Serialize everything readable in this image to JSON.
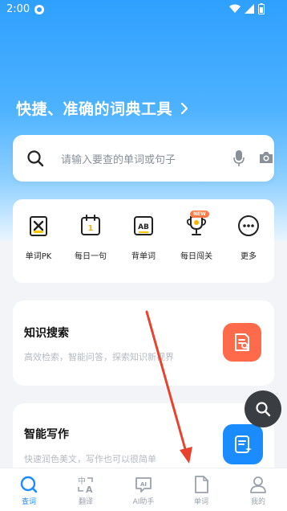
{
  "status_bar": {
    "time": "2:00"
  },
  "hero": {
    "tagline": "快捷、准确的词典工具"
  },
  "search": {
    "placeholder": "请输入要查的单词或句子"
  },
  "tools": [
    {
      "label": "单词PK",
      "icon": "word-pk-icon"
    },
    {
      "label": "每日一句",
      "icon": "calendar-icon"
    },
    {
      "label": "背单词",
      "icon": "ab-card-icon"
    },
    {
      "label": "每日闯关",
      "icon": "trophy-icon",
      "badge": "NEW"
    },
    {
      "label": "更多",
      "icon": "more-icon"
    }
  ],
  "cards": [
    {
      "title": "知识搜索",
      "subtitle": "高效检索，智能问答，探索知识新视界",
      "icon": "knowledge-search-icon",
      "color": "#ff6a4a"
    },
    {
      "title": "智能写作",
      "subtitle": "快速润色美文，写作也可以很简单",
      "icon": "ai-writing-icon",
      "color": "#1a8cff"
    }
  ],
  "tabbar": [
    {
      "label": "查词",
      "icon": "search-icon",
      "active": true
    },
    {
      "label": "翻译",
      "icon": "translate-icon",
      "active": false
    },
    {
      "label": "AI助手",
      "icon": "ai-assistant-icon",
      "active": false
    },
    {
      "label": "单词",
      "icon": "wordbook-icon",
      "active": false
    },
    {
      "label": "我的",
      "icon": "profile-icon",
      "active": false
    }
  ],
  "colors": {
    "primary": "#1a8cff",
    "accent_orange": "#ff6a4a",
    "annotation_red": "#e8432e"
  }
}
